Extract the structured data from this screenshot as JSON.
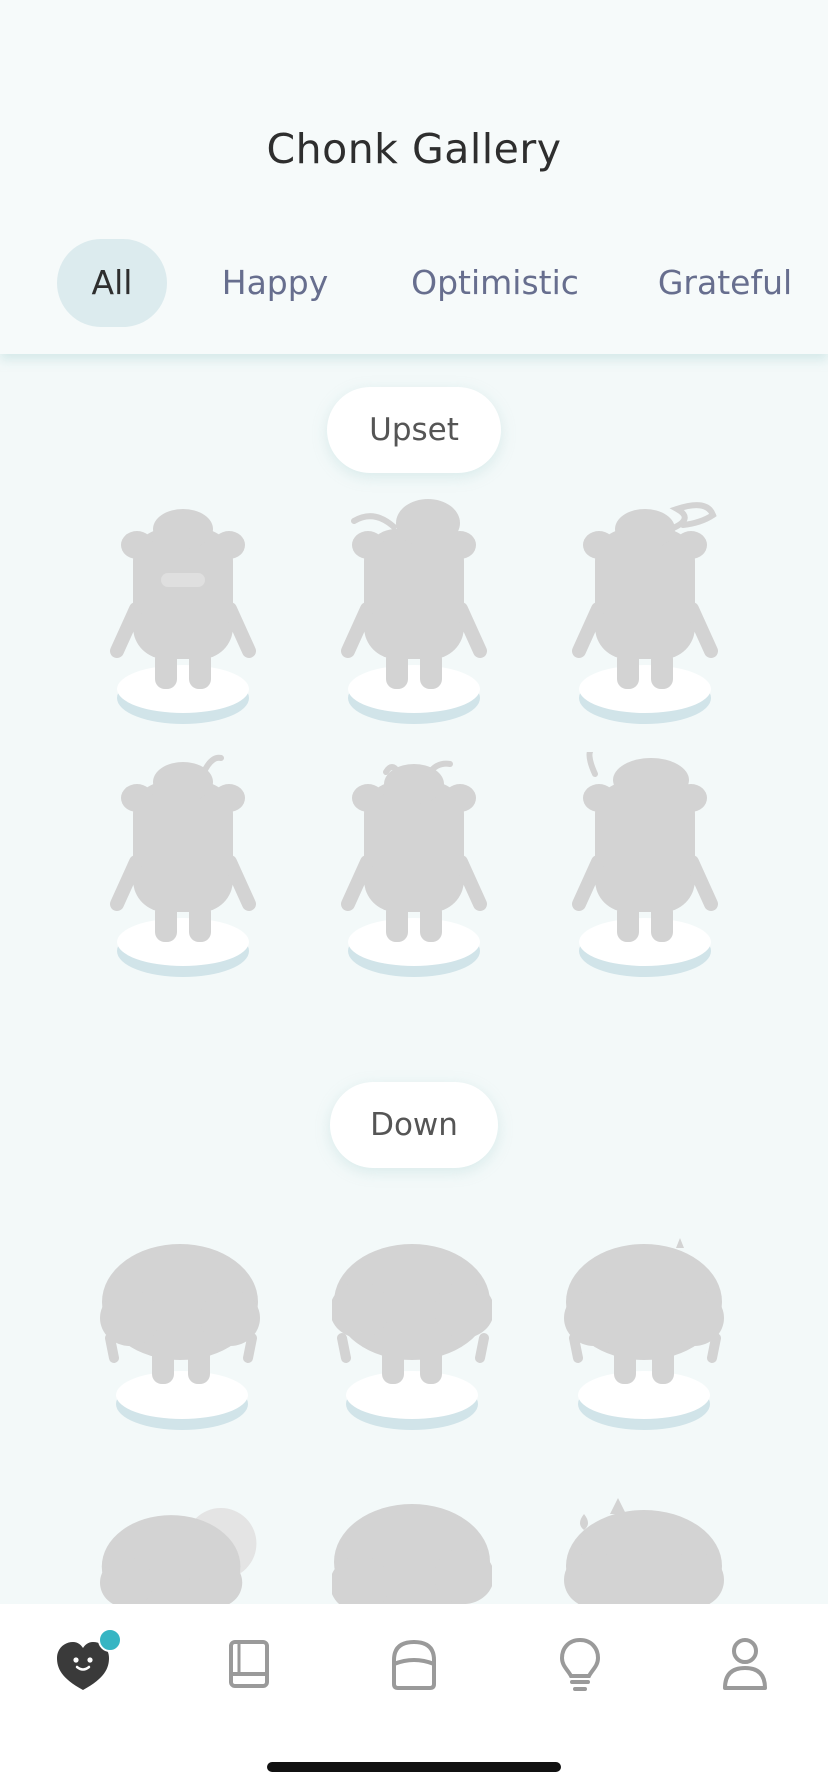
{
  "header": {
    "title": "Chonk Gallery"
  },
  "tabs": [
    {
      "label": "All",
      "active": true
    },
    {
      "label": "Happy",
      "active": false
    },
    {
      "label": "Optimistic",
      "active": false
    },
    {
      "label": "Grateful",
      "active": false
    }
  ],
  "sections": [
    {
      "label": "Upset",
      "unlocked_count": 0
    },
    {
      "label": "Down",
      "unlocked_count": 0
    }
  ],
  "tabbar": {
    "items": [
      {
        "icon": "heart-face-icon",
        "active": true,
        "has_badge": true
      },
      {
        "icon": "book-icon",
        "active": false
      },
      {
        "icon": "dome-icon",
        "active": false
      },
      {
        "icon": "lightbulb-icon",
        "active": false
      },
      {
        "icon": "profile-icon",
        "active": false
      }
    ]
  },
  "colors": {
    "silhouette": "#D3D3D3",
    "accent": "#36B5C3",
    "tab_active_bg": "#DCEBEE",
    "tab_text": "#676E8E"
  }
}
